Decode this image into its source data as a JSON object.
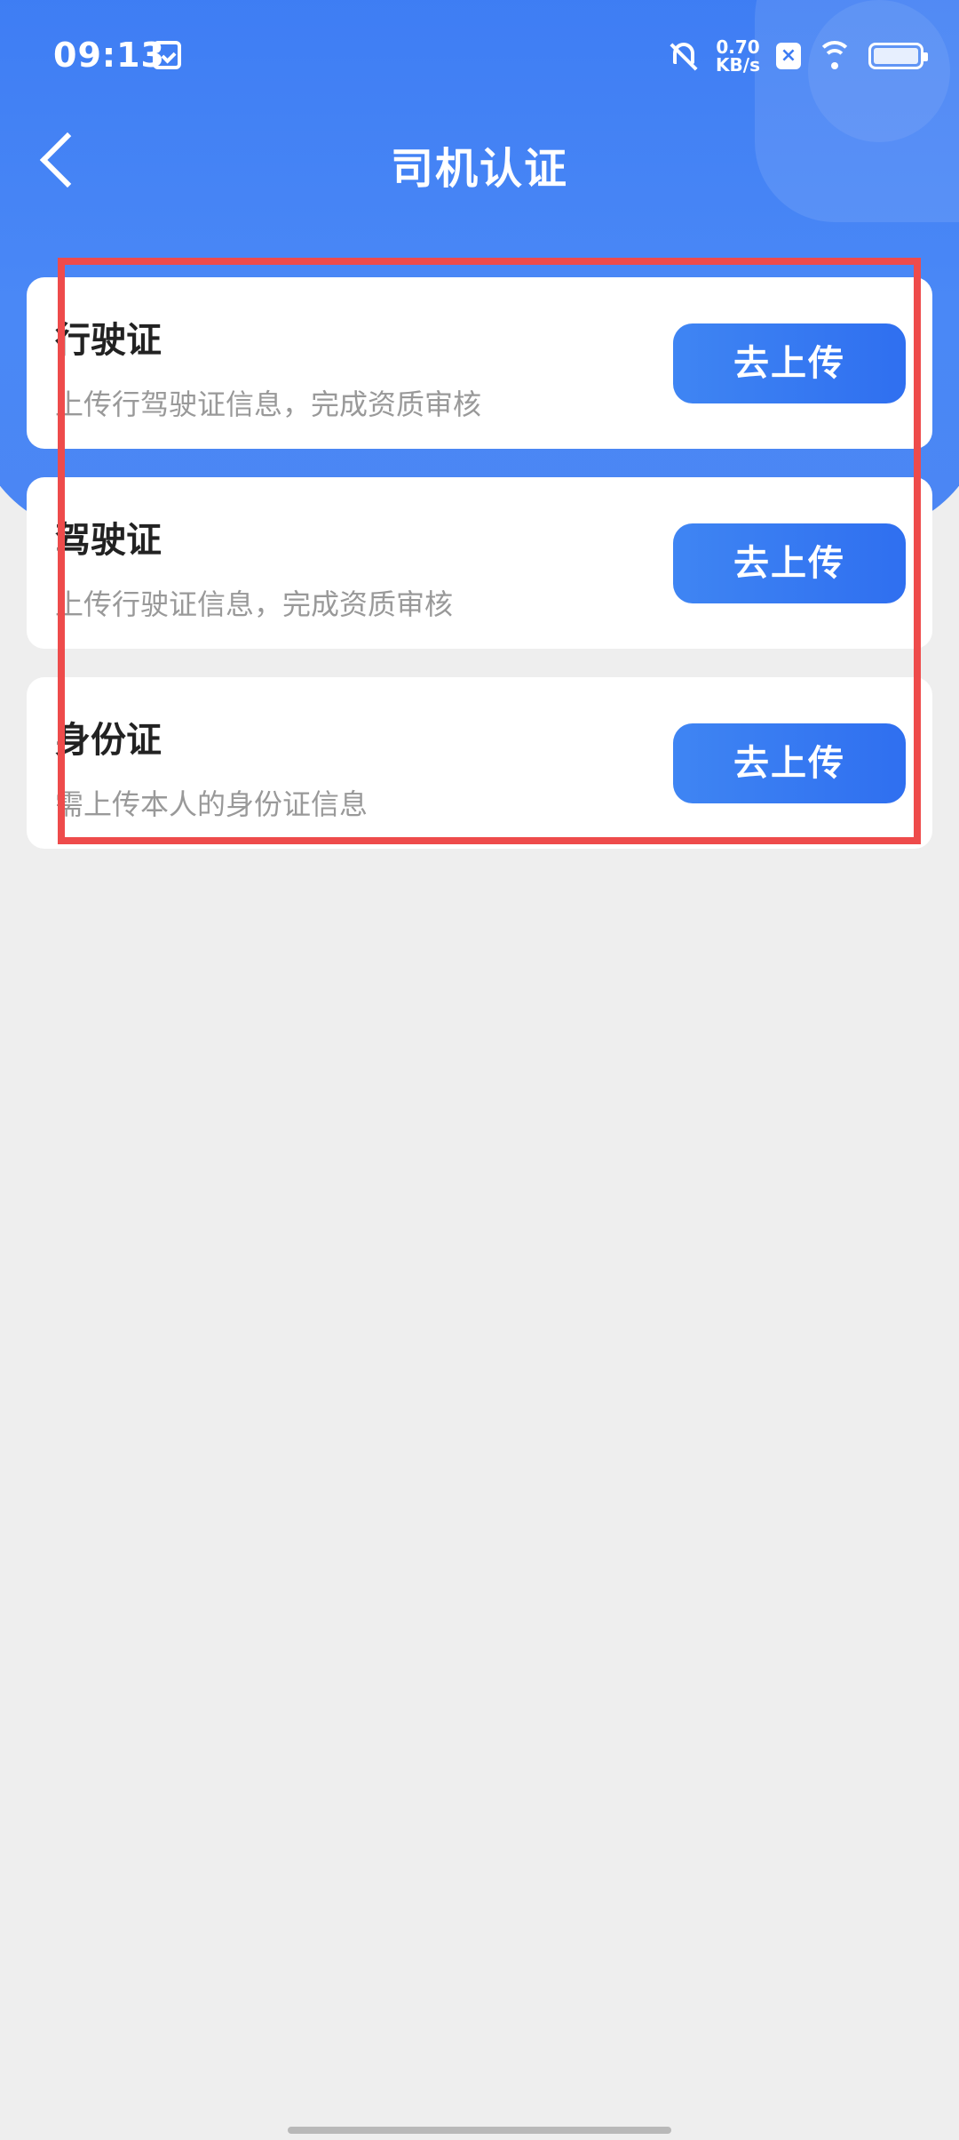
{
  "status_bar": {
    "time": "09:13",
    "net_speed_value": "0.70",
    "net_speed_unit": "KB/s",
    "x_badge": "×"
  },
  "nav": {
    "title": "司机认证"
  },
  "cards": [
    {
      "title": "行驶证",
      "desc": "上传行驾驶证信息，完成资质审核",
      "button": "去上传"
    },
    {
      "title": "驾驶证",
      "desc": "上传行驶证信息，完成资质审核",
      "button": "去上传"
    },
    {
      "title": "身份证",
      "desc": "需上传本人的身份证信息",
      "button": "去上传"
    }
  ],
  "colors": {
    "header_blue": "#3d7cf3",
    "button_blue": "#2f6ff0",
    "highlight_red": "#ee4b4b",
    "page_bg": "#eeeeee"
  }
}
